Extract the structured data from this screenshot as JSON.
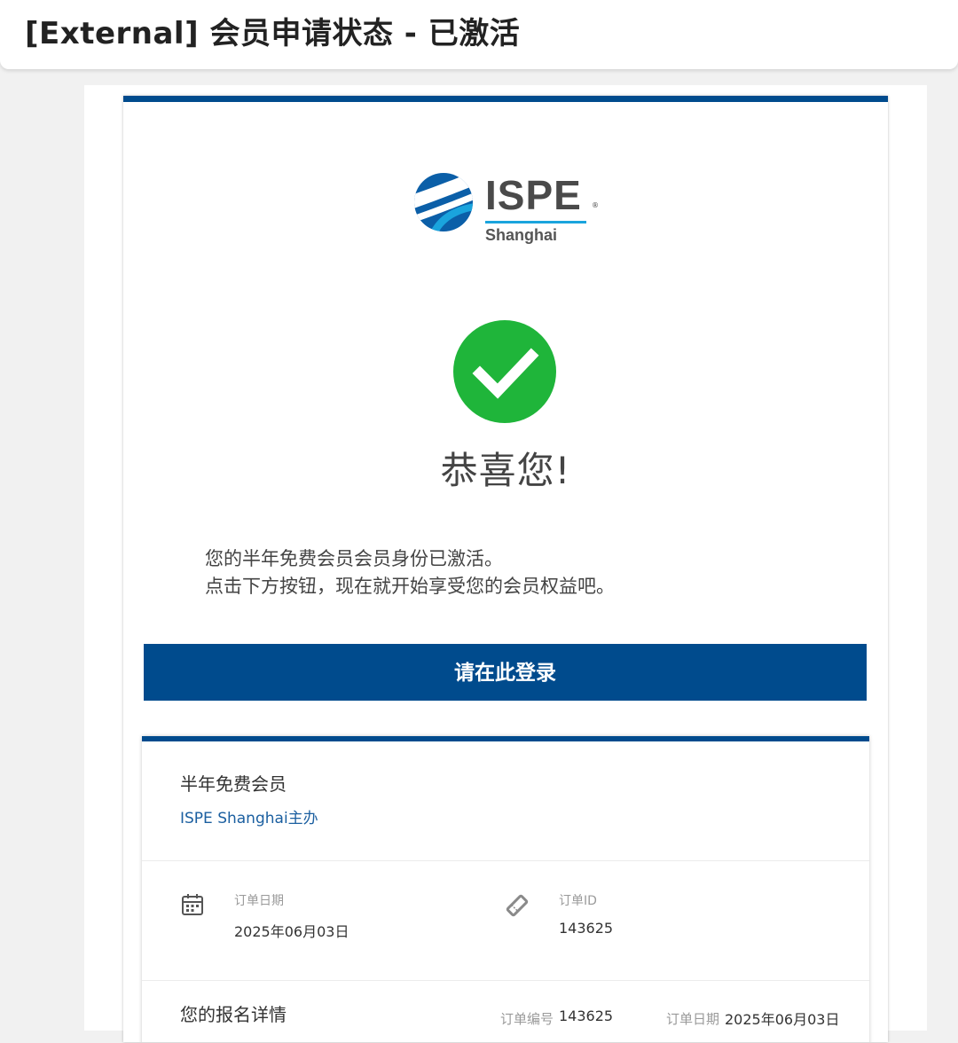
{
  "header": {
    "title": "[External] 会员申请状态 - 已激活"
  },
  "logo": {
    "brand": "ISPE",
    "registered": "®",
    "subtitle": "Shanghai"
  },
  "main": {
    "headline": "恭喜您!",
    "message_line1": "您的半年免费会员会员身份已激活。",
    "message_line2": "点击下方按钮，现在就开始享受您的会员权益吧。",
    "login_button": "请在此登录"
  },
  "order": {
    "plan_name": "半年免费会员",
    "organizer": "ISPE Shanghai主办",
    "order_date_label": "订单日期",
    "order_date_value": "2025年06月03日",
    "order_id_label": "订单ID",
    "order_id_value": "143625",
    "details_title": "您的报名详情",
    "order_no_label": "订单编号",
    "order_no_value": "143625",
    "order_date2_label": "订单日期",
    "order_date2_value": "2025年06月03日"
  },
  "colors": {
    "brand_blue": "#004b8d",
    "success_green": "#1fb53a",
    "logo_cyan": "#1aa4dd"
  },
  "icons": [
    "ispe-globe-logo-icon",
    "success-check-icon",
    "calendar-icon",
    "ticket-icon"
  ]
}
